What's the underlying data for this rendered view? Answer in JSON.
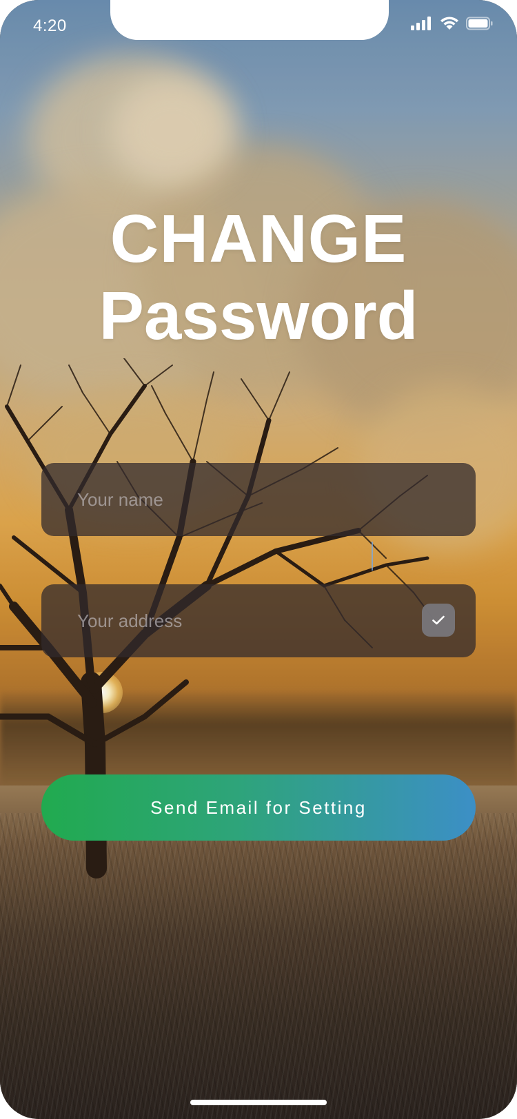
{
  "status_bar": {
    "time": "4:20",
    "icons": [
      "signal-icon",
      "wifi-icon",
      "battery-icon"
    ]
  },
  "title": {
    "line1": "CHANGE",
    "line2": "Password"
  },
  "form": {
    "name_placeholder": "Your name",
    "name_value": "",
    "address_placeholder": "Your address",
    "address_value": "",
    "address_checked": true
  },
  "actions": {
    "send_label": "Send Email for Setting"
  },
  "colors": {
    "button_gradient_start": "#21aa4f",
    "button_gradient_end": "#3c8fc6",
    "field_background": "#322a2c",
    "text": "#ffffff"
  }
}
